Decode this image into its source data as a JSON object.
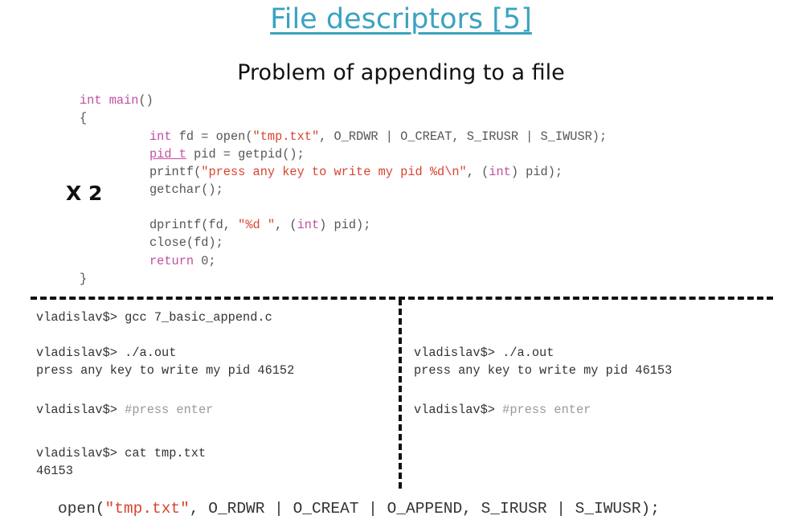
{
  "title": "File descriptors [5]",
  "subtitle": "Problem of appending to a file",
  "repeat_label": "X 2",
  "code": {
    "l1": [
      "int main",
      "()"
    ],
    "l2": "{",
    "l3": [
      "int",
      " fd = open(",
      "\"tmp.txt\"",
      ", O_RDWR | O_CREAT, S_IRUSR | S_IWUSR);"
    ],
    "l4": [
      "pid_t",
      " pid = getpid();"
    ],
    "l5": [
      "printf(",
      "\"press any key to write my pid %d\\n\"",
      ", (",
      "int",
      ") pid);"
    ],
    "l6": "getchar();",
    "l7": [
      "dprintf(fd, ",
      "\"%d \"",
      ", (",
      "int",
      ") pid);"
    ],
    "l8": "close(fd);",
    "l9": [
      "return",
      " 0;"
    ],
    "l10": "}"
  },
  "terminal_left": {
    "cmd_compile": "vladislav$> gcc 7_basic_append.c",
    "cmd_run": "vladislav$> ./a.out",
    "out_pid": "press any key to write my pid 46152",
    "prompt_enter": "vladislav$> ",
    "enter_comment": "#press enter",
    "cmd_cat": "vladislav$> cat tmp.txt",
    "cat_output": "46153"
  },
  "terminal_right": {
    "cmd_run": "vladislav$> ./a.out",
    "out_pid": "press any key to write my pid 46153",
    "prompt_enter": "vladislav$> ",
    "enter_comment": "#press enter"
  },
  "fix_line": [
    "open(",
    "\"tmp.txt\"",
    ", O_RDWR | O_CREAT | O_APPEND, S_IRUSR | S_IWUSR);"
  ]
}
